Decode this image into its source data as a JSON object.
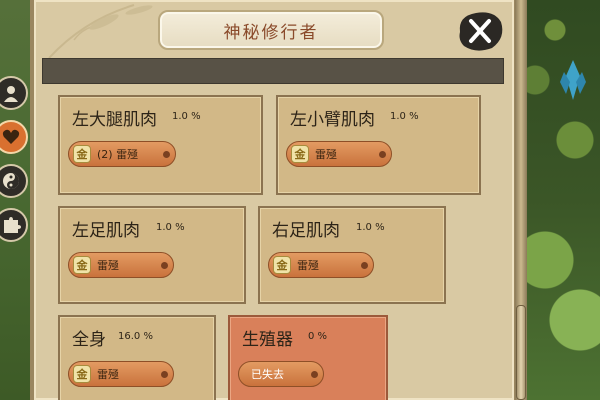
{
  "window": {
    "title": "神秘修行者"
  },
  "side_tabs": [
    {
      "icon": "person-silhouette-icon",
      "active": false
    },
    {
      "icon": "heart-icon",
      "active": true
    },
    {
      "icon": "yin-yang-icon",
      "active": false
    },
    {
      "icon": "puzzle-piece-icon",
      "active": false
    }
  ],
  "body_parts": [
    {
      "name": "左大腿肌肉",
      "percent": "1.0 %",
      "item": "(2) 雷殛",
      "lost": false
    },
    {
      "name": "左小臂肌肉",
      "percent": "1.0 %",
      "item": "雷殛",
      "lost": false
    },
    {
      "name": "左足肌肉",
      "percent": "1.0 %",
      "item": "雷殛",
      "lost": false
    },
    {
      "name": "右足肌肉",
      "percent": "1.0 %",
      "item": "雷殛",
      "lost": false
    },
    {
      "name": "全身",
      "percent": "16.0 %",
      "item": "雷殛",
      "lost": false
    },
    {
      "name": "生殖器",
      "percent": "0 %",
      "item": "已失去",
      "lost": true
    }
  ],
  "colors": {
    "panel_bg": "#d9c9a3",
    "card_bg": "#d2b887",
    "lost_card_bg": "#d9805a",
    "pill_orange": "#d9823f",
    "title_text": "#8a4a2a"
  }
}
